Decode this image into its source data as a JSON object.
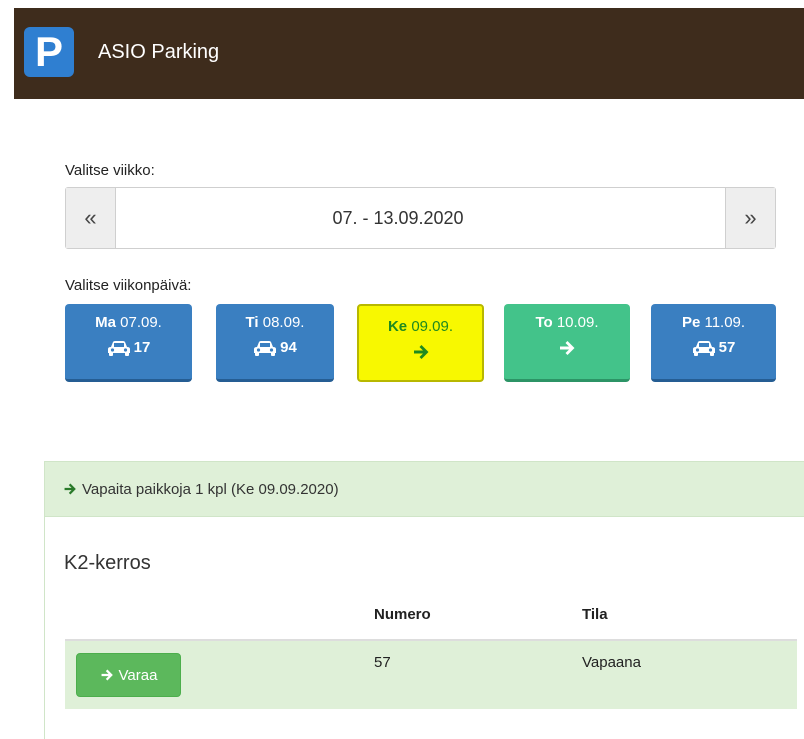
{
  "app": {
    "logo_letter": "P",
    "title": "ASIO Parking",
    "brand_color": "#3e2c1c",
    "logo_color": "#2f7fd1"
  },
  "week": {
    "label": "Valitse viikko:",
    "prev_symbol": "«",
    "range": "07. - 13.09.2020",
    "next_symbol": "»"
  },
  "days": {
    "label": "Valitse viikonpäivä:",
    "items": [
      {
        "abbr": "Ma",
        "date": "07.09.",
        "icon": "car-icon",
        "count": "17",
        "style": "blue"
      },
      {
        "abbr": "Ti",
        "date": "08.09.",
        "icon": "car-icon",
        "count": "94",
        "style": "blue"
      },
      {
        "abbr": "Ke",
        "date": "09.09.",
        "icon": "arrow-right-icon",
        "count": "",
        "style": "yellow-selected"
      },
      {
        "abbr": "To",
        "date": "10.09.",
        "icon": "arrow-right-icon",
        "count": "",
        "style": "green"
      },
      {
        "abbr": "Pe",
        "date": "11.09.",
        "icon": "car-icon",
        "count": "57",
        "style": "blue"
      }
    ]
  },
  "results": {
    "header": "Vapaita paikkoja 1 kpl (Ke 09.09.2020)",
    "section_title": "K2-kerros",
    "columns": [
      "",
      "Numero",
      "Tila"
    ],
    "rows": [
      {
        "action": "Varaa",
        "number": "57",
        "status": "Vapaana"
      }
    ]
  }
}
